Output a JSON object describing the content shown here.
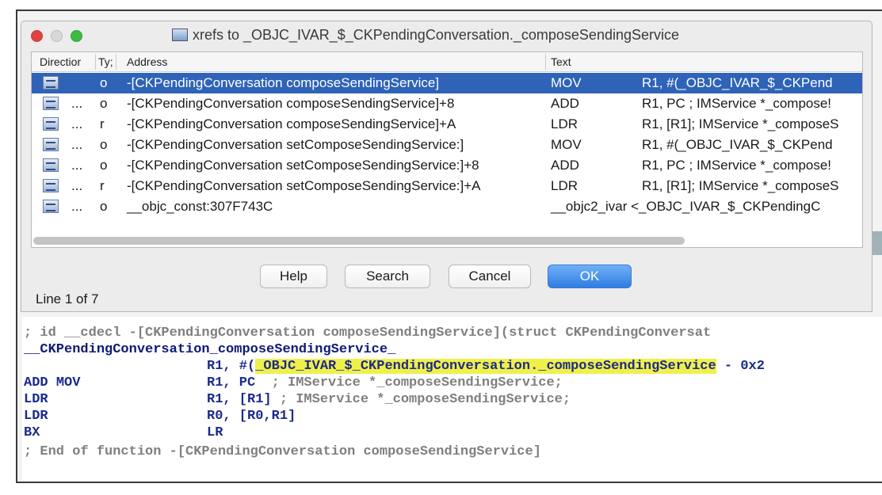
{
  "dialog": {
    "title": "xrefs to _OBJC_IVAR_$_CKPendingConversation._composeSendingService",
    "columns": {
      "direction": "Directior",
      "type": "Ty;",
      "address": "Address",
      "text": "Text"
    },
    "rows": [
      {
        "dir": "",
        "type": "o",
        "address": "-[CKPendingConversation composeSendingService]",
        "op": "MOV",
        "args": "R1, #(_OBJC_IVAR_$_CKPend",
        "selected": true
      },
      {
        "dir": "...",
        "type": "o",
        "address": "-[CKPendingConversation composeSendingService]+8",
        "op": "ADD",
        "args": "R1, PC  ; IMService *_compose!"
      },
      {
        "dir": "...",
        "type": "r",
        "address": "-[CKPendingConversation composeSendingService]+A",
        "op": "LDR",
        "args": "R1, [R1]; IMService *_composeS"
      },
      {
        "dir": "...",
        "type": "o",
        "address": "-[CKPendingConversation setComposeSendingService:]",
        "op": "MOV",
        "args": "R1, #(_OBJC_IVAR_$_CKPend"
      },
      {
        "dir": "...",
        "type": "o",
        "address": "-[CKPendingConversation setComposeSendingService:]+8",
        "op": "ADD",
        "args": "R1, PC  ; IMService *_compose!"
      },
      {
        "dir": "...",
        "type": "r",
        "address": "-[CKPendingConversation setComposeSendingService:]+A",
        "op": "LDR",
        "args": "R1, [R1]; IMService *_composeS"
      },
      {
        "dir": "...",
        "type": "o",
        "address": "__objc_const:307F743C",
        "op": "__objc2_ivar <_OBJC_IVAR_$_CKPendingC",
        "args": ""
      }
    ],
    "buttons": {
      "help": "Help",
      "search": "Search",
      "cancel": "Cancel",
      "ok": "OK"
    },
    "status": "Line 1 of 7"
  },
  "disassembly": {
    "header_comment": "; id __cdecl -[CKPendingConversation composeSendingService](struct CKPendingConversat",
    "label": "__CKPendingConversation_composeSendingService_",
    "lines": [
      {
        "mnemonic": "MOV",
        "operands_pre": "R1, #(",
        "highlight": "_OBJC_IVAR_$_CKPendingConversation._composeSendingService",
        "operands_post": " - 0x2"
      },
      {
        "mnemonic": "ADD",
        "operands": "R1, PC  ",
        "comment": "; IMService *_composeSendingService;"
      },
      {
        "mnemonic": "LDR",
        "operands": "R1, [R1] ",
        "comment": "; IMService *_composeSendingService;"
      },
      {
        "mnemonic": "LDR",
        "operands": "R0, [R0,R1]",
        "comment": ""
      },
      {
        "mnemonic": "BX",
        "operands": "LR",
        "comment": ""
      }
    ],
    "end_comment": "; End of function -[CKPendingConversation composeSendingService]"
  }
}
